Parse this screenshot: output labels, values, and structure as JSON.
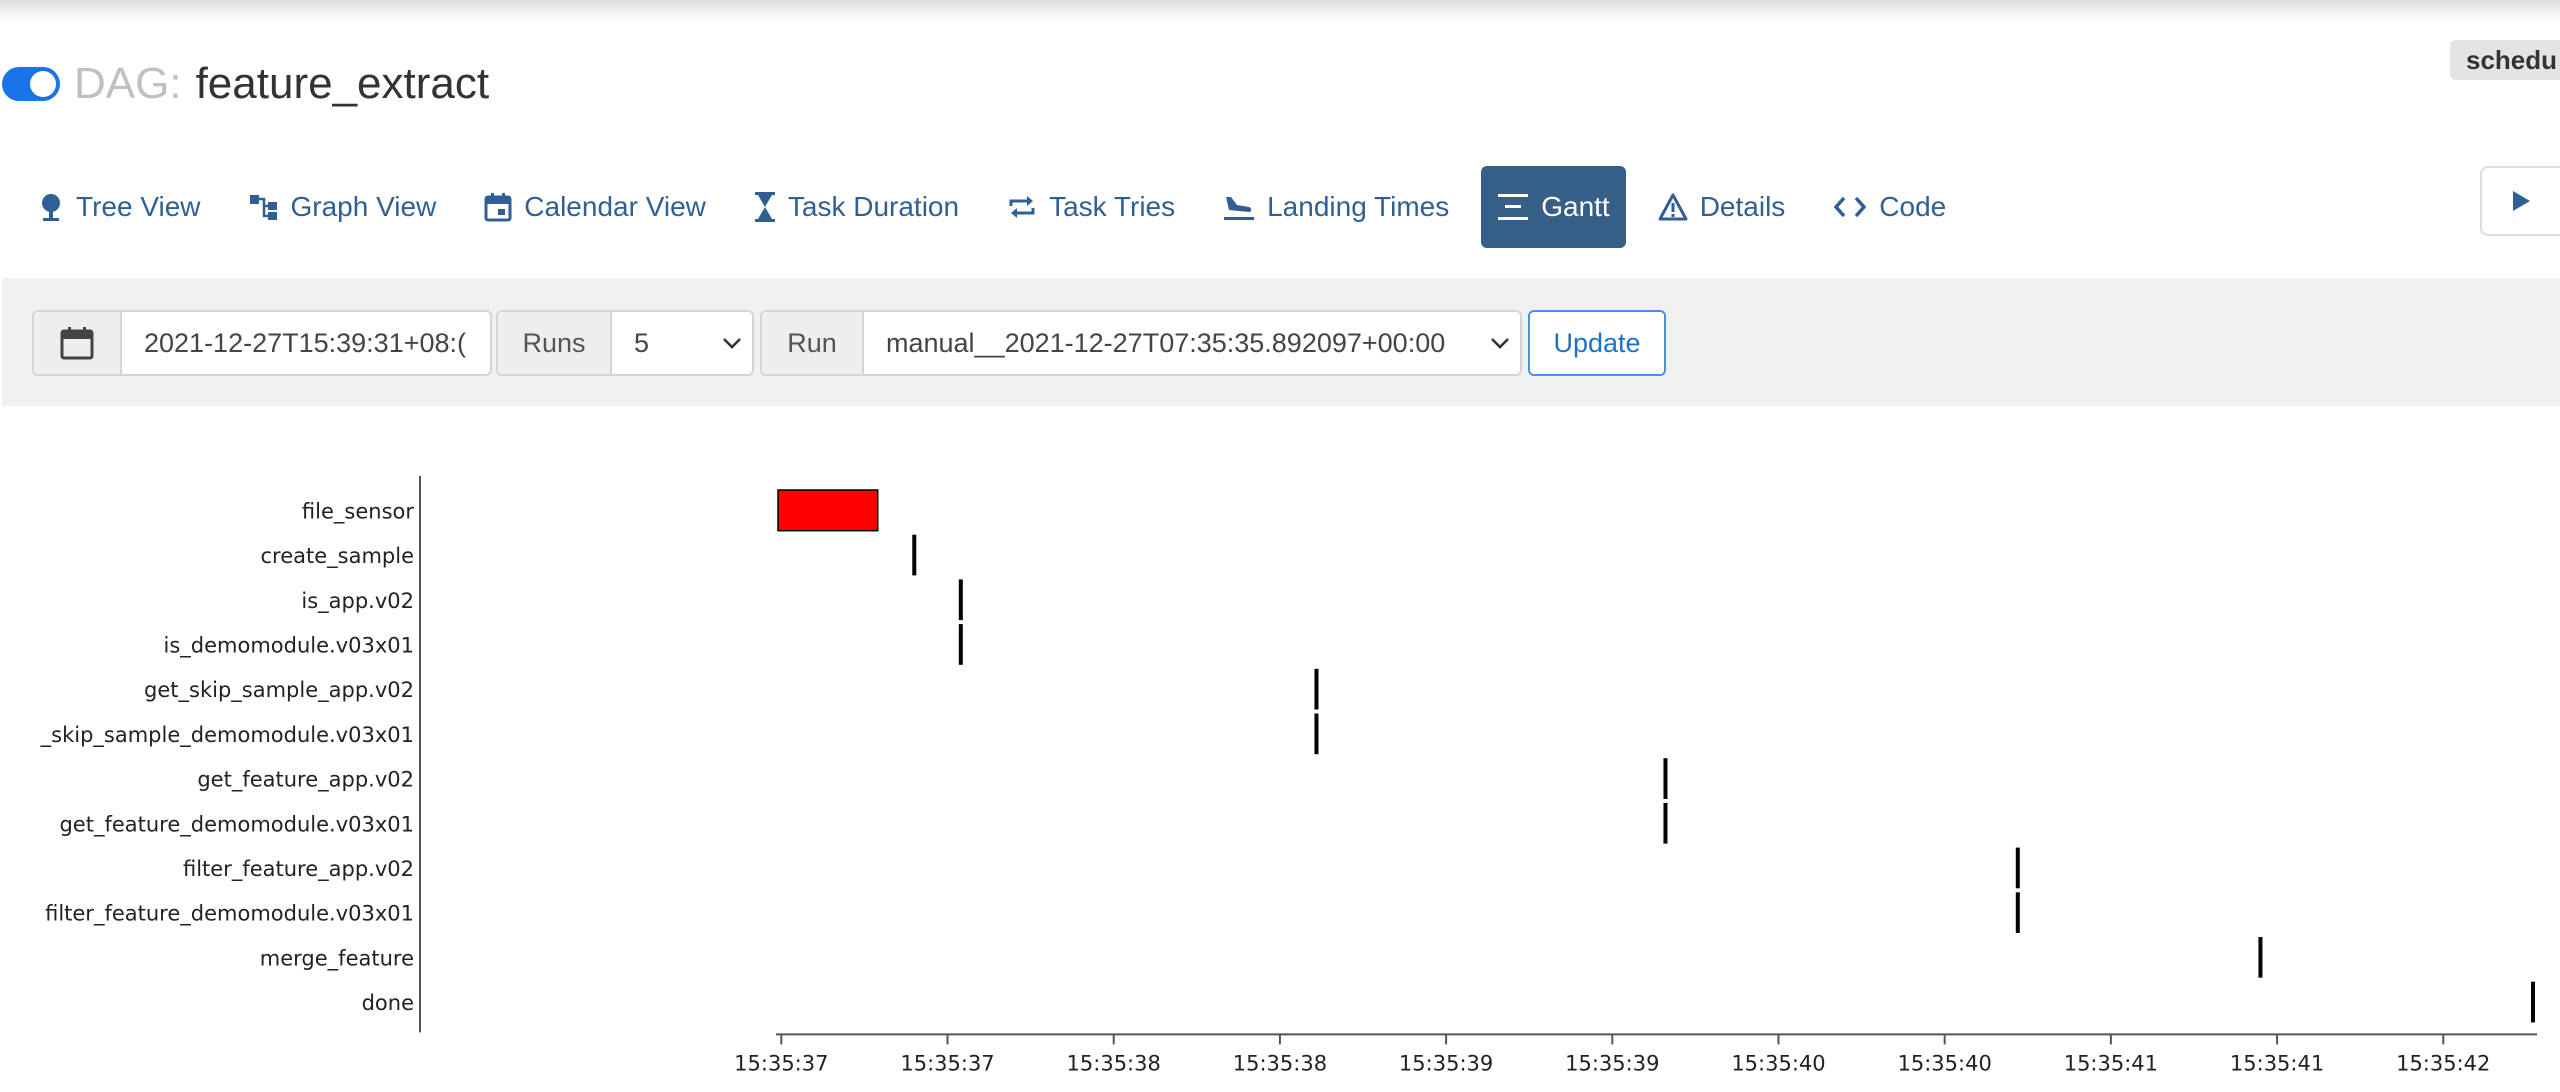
{
  "dag": {
    "label": "DAG:",
    "name": "feature_extract",
    "schedule_badge": "schedu"
  },
  "nav": [
    {
      "icon": "tree-icon",
      "label": "Tree View"
    },
    {
      "icon": "graph-icon",
      "label": "Graph View"
    },
    {
      "icon": "calendar-icon",
      "label": "Calendar View"
    },
    {
      "icon": "hourglass-icon",
      "label": "Task Duration"
    },
    {
      "icon": "retry-icon",
      "label": "Task Tries"
    },
    {
      "icon": "landing-icon",
      "label": "Landing Times"
    },
    {
      "icon": "gantt-icon",
      "label": "Gantt",
      "active": true
    },
    {
      "icon": "warning-icon",
      "label": "Details"
    },
    {
      "icon": "code-icon",
      "label": "Code"
    }
  ],
  "filters": {
    "date_value": "2021-12-27T15:39:31+08:(",
    "runs_label": "Runs",
    "runs_value": "5",
    "run_label": "Run",
    "run_value": "manual__2021-12-27T07:35:35.892097+00:00",
    "update_label": "Update"
  },
  "colors": {
    "accent": "#365f87",
    "failed": "#ff0000",
    "success": "#000000"
  },
  "chart_data": {
    "type": "gantt",
    "tasks": [
      "file_sensor",
      "create_sample",
      "is_app.v02",
      "is_demomodule.v03x01",
      "get_skip_sample_app.v02",
      "_skip_sample_demomodule.v03x01",
      "get_feature_app.v02",
      "get_feature_demomodule.v03x01",
      "filter_feature_app.v02",
      "filter_feature_demomodule.v03x01",
      "merge_feature",
      "done"
    ],
    "x_tick_labels": [
      "15:35:37",
      "15:35:37",
      "15:35:38",
      "15:35:38",
      "15:35:39",
      "15:35:39",
      "15:35:40",
      "15:35:40",
      "15:35:41",
      "15:35:41",
      "15:35:42"
    ],
    "x_tick_values": [
      37.0,
      37.5,
      38.0,
      38.5,
      39.0,
      39.5,
      40.0,
      40.5,
      41.0,
      41.5,
      42.0
    ],
    "x_range": [
      36.99,
      42.27
    ],
    "bars": [
      {
        "task": "file_sensor",
        "start": 36.99,
        "end": 37.29,
        "state": "failed"
      },
      {
        "task": "create_sample",
        "start": 37.4,
        "end": 37.41,
        "state": "success"
      },
      {
        "task": "is_app.v02",
        "start": 37.54,
        "end": 37.55,
        "state": "success"
      },
      {
        "task": "is_demomodule.v03x01",
        "start": 37.54,
        "end": 37.55,
        "state": "success"
      },
      {
        "task": "get_skip_sample_app.v02",
        "start": 38.61,
        "end": 38.62,
        "state": "success"
      },
      {
        "task": "_skip_sample_demomodule.v03x01",
        "start": 38.61,
        "end": 38.62,
        "state": "success"
      },
      {
        "task": "get_feature_app.v02",
        "start": 39.66,
        "end": 39.67,
        "state": "success"
      },
      {
        "task": "get_feature_demomodule.v03x01",
        "start": 39.66,
        "end": 39.67,
        "state": "success"
      },
      {
        "task": "filter_feature_app.v02",
        "start": 40.72,
        "end": 40.73,
        "state": "success"
      },
      {
        "task": "filter_feature_demomodule.v03x01",
        "start": 40.72,
        "end": 40.73,
        "state": "success"
      },
      {
        "task": "merge_feature",
        "start": 41.45,
        "end": 41.46,
        "state": "success"
      },
      {
        "task": "done",
        "start": 42.27,
        "end": 42.28,
        "state": "success"
      }
    ]
  }
}
